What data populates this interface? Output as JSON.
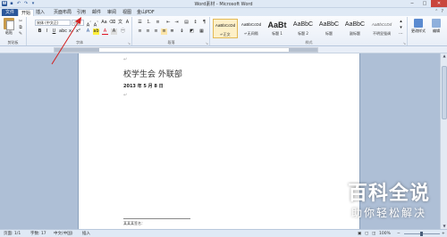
{
  "window": {
    "title": "Word素材 - Microsoft Word",
    "minimize": "─",
    "maximize": "□",
    "close": "✕"
  },
  "tabs": [
    "文件",
    "开始",
    "插入",
    "页面布局",
    "引用",
    "邮件",
    "审阅",
    "视图",
    "金山PDF"
  ],
  "ribbon": {
    "clipboard": {
      "paste_label": "粘贴",
      "group_label": "剪贴板"
    },
    "font": {
      "font_name": "宋体 (中文正)",
      "font_size": "小五",
      "group_label": "字体"
    },
    "paragraph": {
      "group_label": "段落"
    },
    "styles": {
      "group_label": "样式",
      "items": [
        {
          "sample": "AaBbCcDd",
          "name": "↵正文"
        },
        {
          "sample": "AaBbCcDd",
          "name": "↵无间隔"
        },
        {
          "sample": "AaBt",
          "name": "标题 1"
        },
        {
          "sample": "AaBbC",
          "name": "标题 2"
        },
        {
          "sample": "AaBbC",
          "name": "标题"
        },
        {
          "sample": "AaBbC",
          "name": "副标题"
        },
        {
          "sample": "AaBbCcDd",
          "name": "不明显强调"
        }
      ],
      "change_styles": "更改样式"
    },
    "editing": {
      "label": "编辑"
    }
  },
  "document": {
    "title": "校学生会 外联部",
    "date": "2013 年 5 月 8 日",
    "footnote": "某某某签名："
  },
  "status": {
    "page": "页面: 1/1",
    "words": "字数: 17",
    "language": "中文(中国)",
    "mode": "插入",
    "zoom": "100%"
  },
  "watermark": {
    "main": "百科全说",
    "sub": "助你轻松解决"
  }
}
